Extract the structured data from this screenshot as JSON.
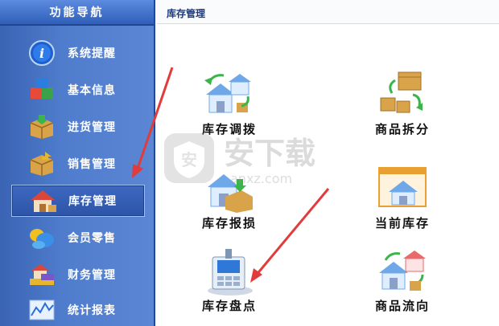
{
  "sidebar": {
    "title": "功能导航",
    "items": [
      {
        "label": "系统提醒",
        "icon": "info-icon"
      },
      {
        "label": "基本信息",
        "icon": "cubes-icon"
      },
      {
        "label": "进货管理",
        "icon": "box-in-icon"
      },
      {
        "label": "销售管理",
        "icon": "box-out-icon"
      },
      {
        "label": "库存管理",
        "icon": "warehouse-icon",
        "active": true
      },
      {
        "label": "会员零售",
        "icon": "members-icon"
      },
      {
        "label": "财务管理",
        "icon": "finance-icon"
      },
      {
        "label": "统计报表",
        "icon": "chart-icon"
      }
    ]
  },
  "main": {
    "title": "库存管理",
    "tiles": [
      {
        "label": "库存调拨",
        "icon": "stock-transfer-icon"
      },
      {
        "label": "商品拆分",
        "icon": "product-split-icon"
      },
      {
        "label": "库存报损",
        "icon": "stock-loss-icon"
      },
      {
        "label": "当前库存",
        "icon": "current-stock-icon"
      },
      {
        "label": "库存盘点",
        "icon": "stock-check-icon"
      },
      {
        "label": "商品流向",
        "icon": "product-flow-icon"
      }
    ]
  },
  "watermark": {
    "text": "安下载",
    "subtext": "anxz.com"
  },
  "colors": {
    "sidebar": "#4f7ccc",
    "accent_arrow": "#e23b3b",
    "title": "#1f3a7a"
  }
}
